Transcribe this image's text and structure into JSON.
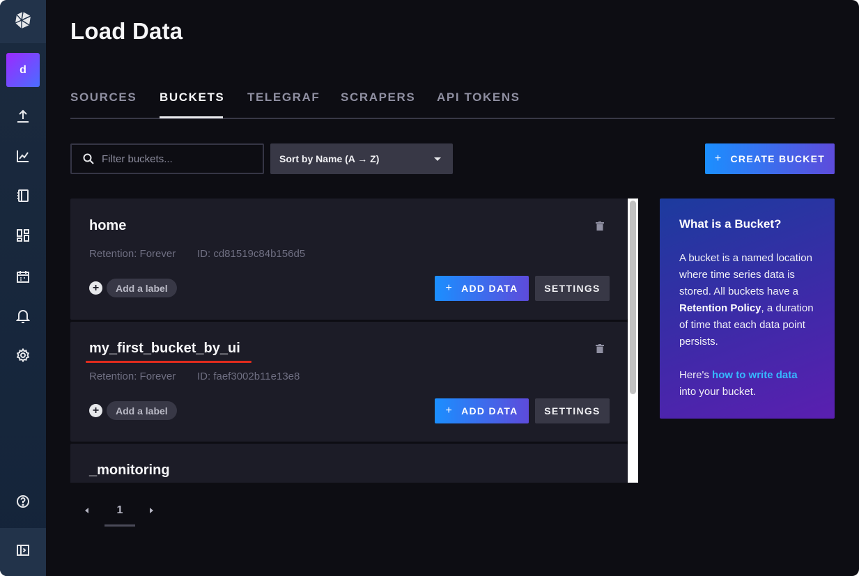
{
  "page": {
    "title": "Load Data"
  },
  "sidebar": {
    "avatar_letter": "d",
    "icons": [
      "influx-logo-icon",
      "upload-icon",
      "graph-icon",
      "notebook-icon",
      "dashboards-icon",
      "calendar-icon",
      "bell-icon",
      "gear-icon",
      "help-icon",
      "collapse-icon"
    ]
  },
  "tabs": [
    {
      "label": "SOURCES",
      "active": false
    },
    {
      "label": "BUCKETS",
      "active": true
    },
    {
      "label": "TELEGRAF",
      "active": false
    },
    {
      "label": "SCRAPERS",
      "active": false
    },
    {
      "label": "API TOKENS",
      "active": false
    }
  ],
  "toolbar": {
    "filter_placeholder": "Filter buckets...",
    "sort_label": "Sort by Name (A → Z)",
    "create_plus": "+",
    "create_label": "CREATE BUCKET"
  },
  "buckets": [
    {
      "name": "home",
      "retention": "Retention: Forever",
      "id": "ID: cd81519c84b156d5",
      "add_label": "Add a label",
      "add_data": "ADD DATA",
      "settings": "SETTINGS",
      "plus": "+"
    },
    {
      "name": "my_first_bucket_by_ui",
      "retention": "Retention: Forever",
      "id": "ID: faef3002b11e13e8",
      "add_label": "Add a label",
      "add_data": "ADD DATA",
      "settings": "SETTINGS",
      "plus": "+"
    },
    {
      "name": "_monitoring"
    }
  ],
  "info": {
    "title": "What is a Bucket?",
    "p1_a": "A bucket is a named location where time series data is stored. All buckets have a ",
    "p1_bold": "Retention Policy",
    "p1_b": ", a duration of time that each data point persists.",
    "p2_a": "Here's ",
    "p2_link": "how to write data",
    "p2_b": " into your bucket."
  },
  "pagination": {
    "current": "1"
  },
  "colors": {
    "accent_start": "#1b8fff",
    "accent_end": "#5d4bdb",
    "highlight": "#e02b1d"
  }
}
